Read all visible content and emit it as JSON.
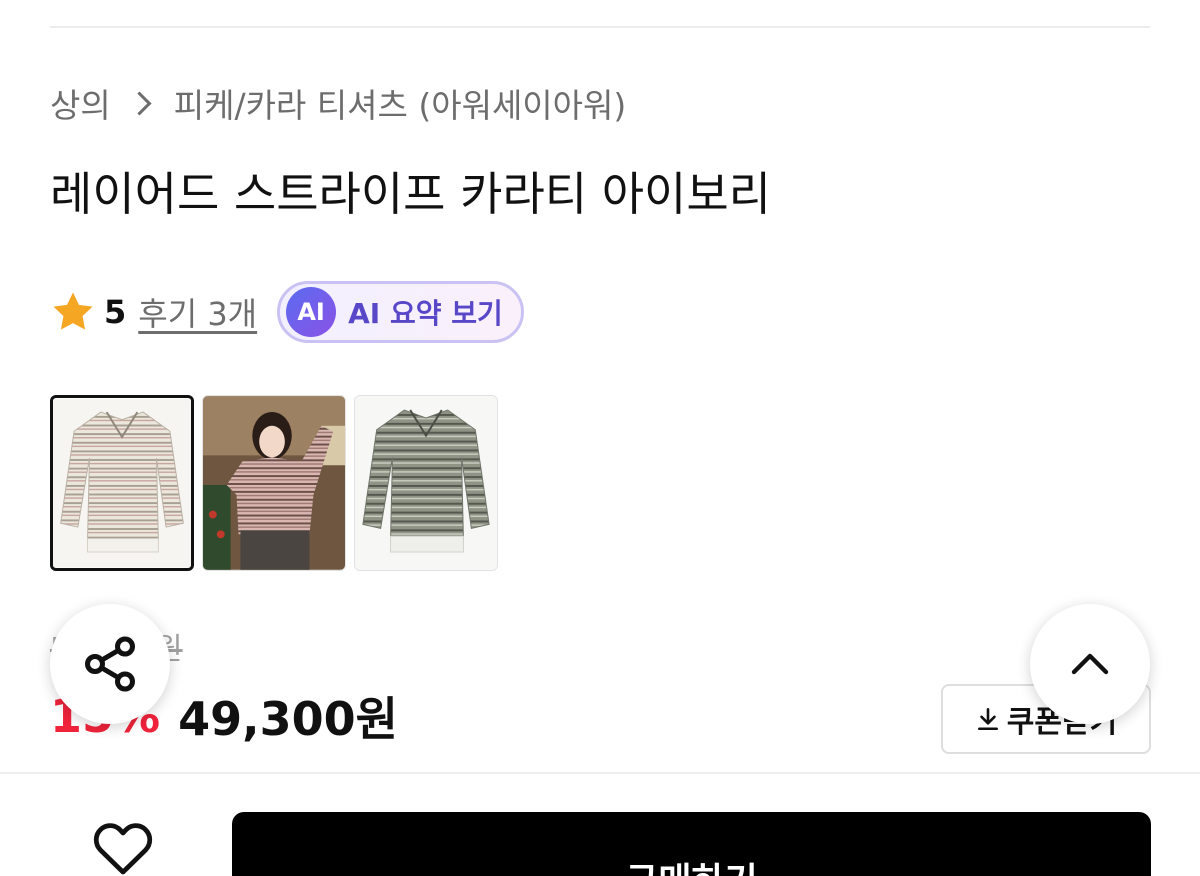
{
  "breadcrumb": {
    "category": "상의",
    "subcategory": "피케/카라 티셔츠 (아워세이아워)"
  },
  "product": {
    "title": "레이어드 스트라이프 카라티 아이보리",
    "rating": "5",
    "review_link": "후기 3개",
    "ai_badge": "AI",
    "ai_summary_label": "AI 요약 보기"
  },
  "price": {
    "original": "58,000원",
    "discount": "15%",
    "sale": "49,300원",
    "coupon_label": "쿠폰받기"
  },
  "bottom_bar": {
    "buy_label": "구매하기"
  },
  "colors": {
    "discount": "#f0233b",
    "ai_accent": "#5848c8",
    "star": "#f5a623",
    "buy_button": "#000000"
  },
  "icons": {
    "star": "star-icon",
    "share": "share-icon",
    "scroll_top": "chevron-up-icon",
    "download": "download-icon",
    "wishlist": "heart-icon"
  }
}
